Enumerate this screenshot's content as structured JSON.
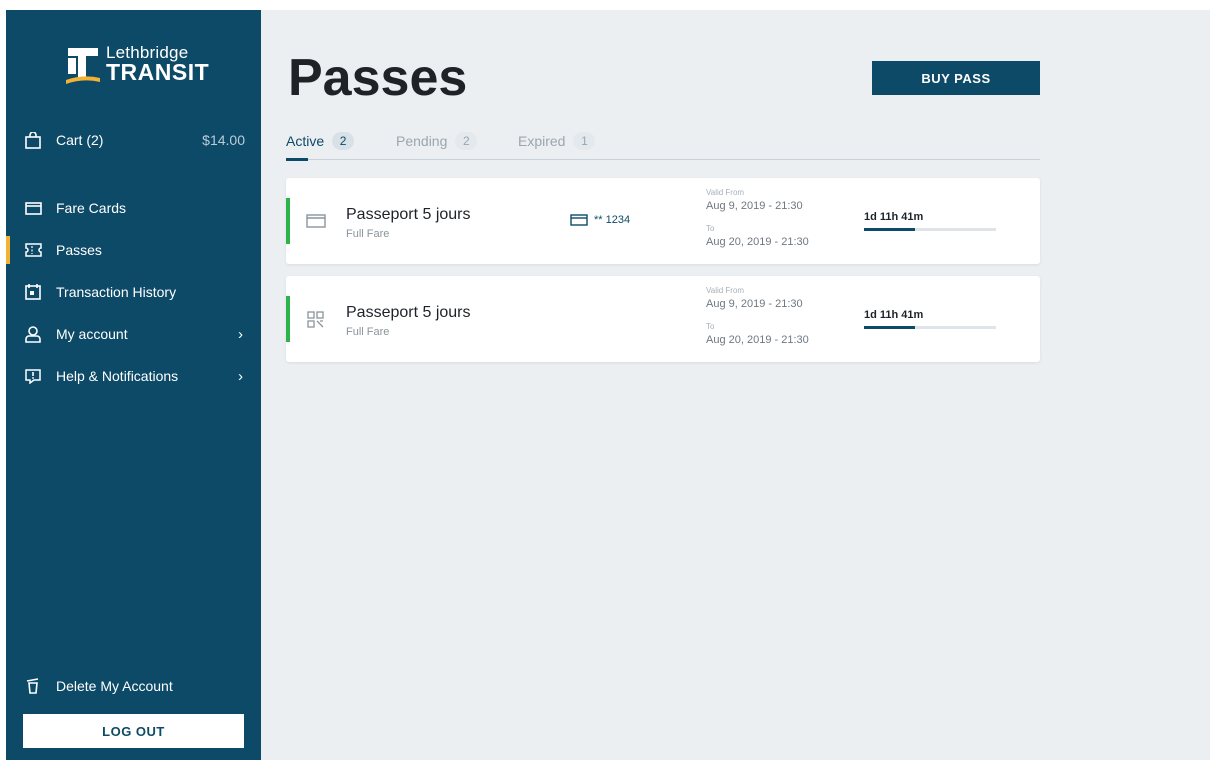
{
  "sidebar": {
    "logo": {
      "line1": "Lethbridge",
      "line2": "TRANSIT"
    },
    "cart": {
      "label": "Cart (2)",
      "amount": "$14.00"
    },
    "items": [
      {
        "label": "Fare Cards",
        "icon": "card-icon"
      },
      {
        "label": "Passes",
        "icon": "ticket-icon",
        "active": true
      },
      {
        "label": "Transaction History",
        "icon": "calendar-icon"
      },
      {
        "label": "My account",
        "icon": "user-icon",
        "chevron": "›"
      },
      {
        "label": "Help & Notifications",
        "icon": "alert-chat-icon",
        "chevron": "›"
      }
    ],
    "delete_account": "Delete My Account",
    "logout": "LOG OUT"
  },
  "main": {
    "title": "Passes",
    "buy_pass": "BUY PASS",
    "tabs": [
      {
        "label": "Active",
        "count": "2"
      },
      {
        "label": "Pending",
        "count": "2"
      },
      {
        "label": "Expired",
        "count": "1"
      }
    ],
    "passes": [
      {
        "name": "Passeport 5 jours",
        "fare": "Full Fare",
        "type_icon": "card-icon",
        "card_ref": "** 1234",
        "valid_from_label": "Valid From",
        "valid_from": "Aug 9, 2019 - 21:30",
        "valid_to_label": "To",
        "valid_to": "Aug 20, 2019 - 21:30",
        "remaining": "1d 11h 41m",
        "progress": 0.39
      },
      {
        "name": "Passeport 5 jours",
        "fare": "Full Fare",
        "type_icon": "qr-code-icon",
        "card_ref": "",
        "valid_from_label": "Valid From",
        "valid_from": "Aug 9, 2019 - 21:30",
        "valid_to_label": "To",
        "valid_to": "Aug 20, 2019 - 21:30",
        "remaining": "1d 11h 41m",
        "progress": 0.39
      }
    ]
  },
  "colors": {
    "sidebar": "#0d4a68",
    "accent_yellow": "#f2b233",
    "active_green": "#2cb34a",
    "primary": "#0d4a68"
  }
}
